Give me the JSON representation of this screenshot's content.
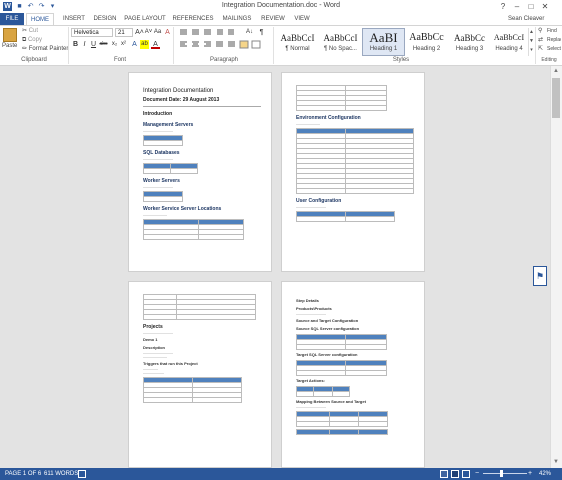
{
  "window": {
    "title": "Integration Documentation.doc - Word",
    "help": "?",
    "minimize": "–",
    "restore": "□",
    "close": "✕"
  },
  "qat": {
    "app_icon": "W",
    "save": "■",
    "undo": "↶",
    "redo": "↷",
    "customize": "▾"
  },
  "tabs": [
    "FILE",
    "HOME",
    "INSERT",
    "DESIGN",
    "PAGE LAYOUT",
    "REFERENCES",
    "MAILINGS",
    "REVIEW",
    "VIEW"
  ],
  "user": "Sean Cleaver",
  "clipboard": {
    "paste": "Paste",
    "cut": "Cut",
    "copy": "Copy",
    "format_painter": "Format Painter",
    "label": "Clipboard"
  },
  "font": {
    "name": "Helvetica",
    "size": "21",
    "bold": "B",
    "italic": "I",
    "underline": "U",
    "strikethrough": "abc",
    "subscript": "x₂",
    "superscript": "x²",
    "grow": "A˄",
    "shrink": "A˅",
    "case": "Aa",
    "clear": "A",
    "effects": "A",
    "highlight": "ab",
    "color": "A",
    "label": "Font"
  },
  "paragraph": {
    "label": "Paragraph",
    "sort": "A↓",
    "pilcrow": "¶"
  },
  "styles": {
    "items": [
      {
        "sample": "AaBbCcI",
        "name": "¶ Normal"
      },
      {
        "sample": "AaBbCcI",
        "name": "¶ No Spac..."
      },
      {
        "sample": "AaBI",
        "name": "Heading 1"
      },
      {
        "sample": "AaBbCc",
        "name": "Heading 2"
      },
      {
        "sample": "AaBbCc",
        "name": "Heading 3"
      },
      {
        "sample": "AaBbCcI",
        "name": "Heading 4"
      }
    ],
    "label": "Styles"
  },
  "editing": {
    "find": "Find",
    "replace": "Replace",
    "select": "Select",
    "label": "Editing"
  },
  "doc": {
    "page1": {
      "title": "Integration Documentation",
      "date": "Document Date: 29 August 2013",
      "intro": "Introduction",
      "mgmt": "Management Servers",
      "sql": "SQL Databases",
      "worker": "Worker Servers",
      "wsl": "Worker Service Server Locations"
    },
    "page2": {
      "env": "Environment Configuration",
      "user": "User Configuration"
    },
    "page3": {
      "projects": "Projects",
      "demo": "Demo 1",
      "desc": "Description",
      "triggers": "Triggers that run this Project"
    },
    "page4": {
      "step": "Step Details",
      "products": "Products\\Products",
      "src_tgt": "Source and Target Configuration",
      "src_sql": "Source SQL Server configuration",
      "tgt_sql": "Target SQL Server configuration",
      "tgt_actions": "Target Actions:",
      "mapping": "Mapping Between Source and Target"
    }
  },
  "status": {
    "page": "PAGE 1 OF 6",
    "words": "611 WORDS",
    "zoom": "42%"
  },
  "colors": {
    "accent": "#2b579a",
    "table_header": "#4f81bd",
    "heading": "#1f3864"
  }
}
